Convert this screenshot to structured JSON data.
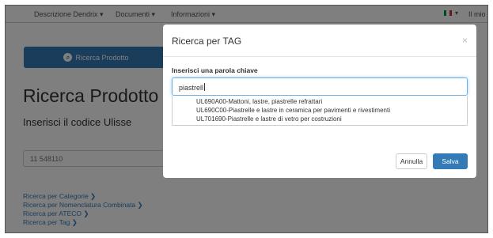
{
  "nav": {
    "items": [
      "Descrizione Dendrix ▾",
      "Documenti ▾",
      "Informazioni ▾"
    ],
    "user": "Il mio conto",
    "flag_colors": [
      "#009246",
      "#ffffff",
      "#ce2b37"
    ]
  },
  "main": {
    "search_button_label": "Ricerca Prodotto",
    "title": "Ricerca Prodotto",
    "subtitle": "Inserisci il codice Ulisse",
    "code_value": "11 548110",
    "links": [
      "Ricerca per Categorie ❯",
      "Ricerca per Nomenclatura Combinata ❯",
      "Ricerca per ATECO ❯",
      "Ricerca per Tag ❯"
    ]
  },
  "modal": {
    "title": "Ricerca per TAG",
    "close": "×",
    "label": "Inserisci una parola chiave",
    "input_value": "piastrell",
    "suggestions": [
      "UL690A00-Mattoni, lastre, piastrelle refrattari",
      "UL690C00-Piastrelle e lastre in ceramica per pavimenti e rivestimenti",
      "UL701690-Piastrelle e lastre di vetro per costruzioni"
    ],
    "cancel_label": "Annulla",
    "save_label": "Salva"
  },
  "colors": {
    "primary": "#337ab7",
    "backdrop": "rgba(0,0,0,0.5)",
    "link": "#337ab7"
  }
}
